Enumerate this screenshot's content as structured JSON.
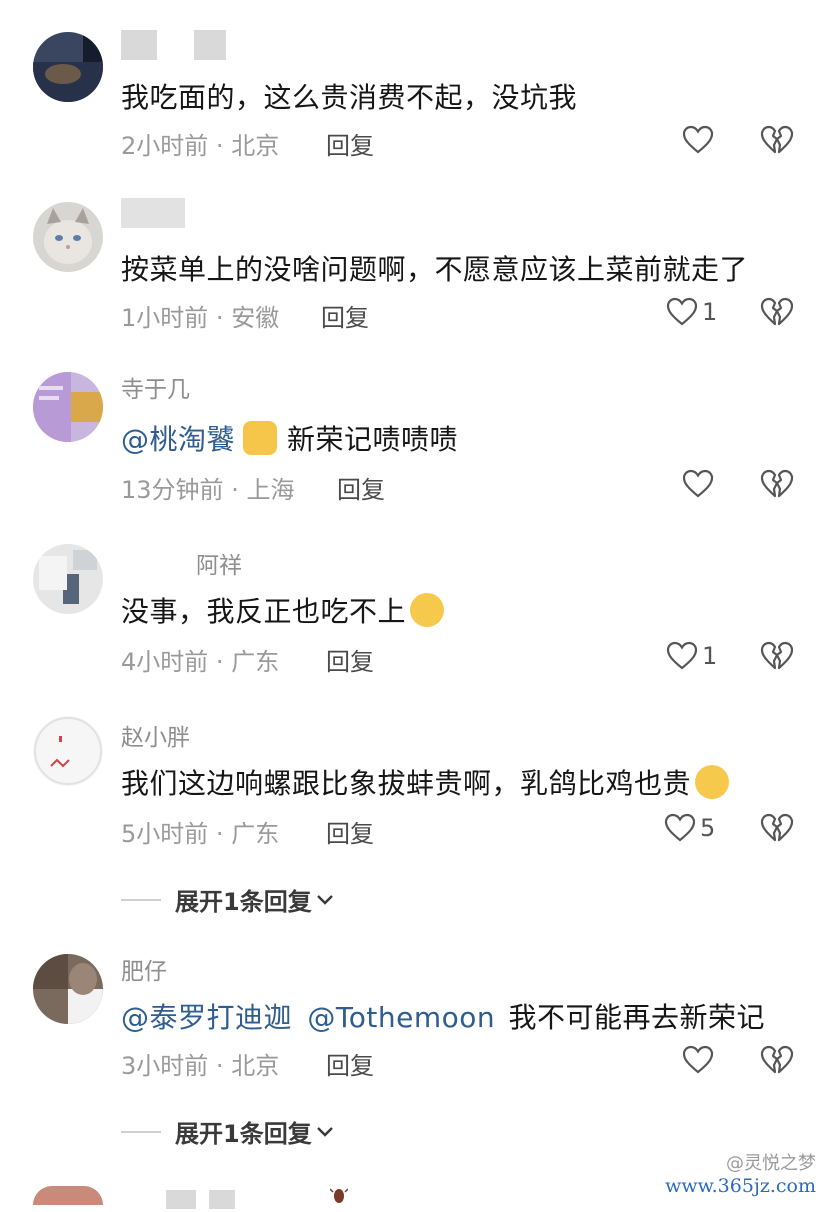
{
  "comments": [
    {
      "text": "我吃面的，这么贵消费不起，没坑我",
      "time": "2小时前",
      "location": "北京",
      "reply": "回复",
      "likes": ""
    },
    {
      "text": "按菜单上的没啥问题啊，不愿意应该上菜前就走了",
      "time": "1小时前",
      "location": "安徽",
      "reply": "回复",
      "likes": "1"
    },
    {
      "username": "寺于几",
      "mention": "@桃淘饕",
      "text": "新荣记啧啧啧",
      "time": "13分钟前",
      "location": "上海",
      "reply": "回复",
      "likes": ""
    },
    {
      "username": "阿祥",
      "text": "没事，我反正也吃不上",
      "time": "4小时前",
      "location": "广东",
      "reply": "回复",
      "likes": "1"
    },
    {
      "username": "赵小胖",
      "text": "我们这边响螺跟比象拔蚌贵啊，乳鸽比鸡也贵",
      "time": "5小时前",
      "location": "广东",
      "reply": "回复",
      "likes": "5",
      "expand": "展开1条回复"
    },
    {
      "username": "肥仔",
      "mention1": "@泰罗打迪迦",
      "mention2": "@Tothemoon",
      "text": "我不可能再去新荣记",
      "time": "3小时前",
      "location": "北京",
      "reply": "回复",
      "likes": "",
      "expand": "展开1条回复"
    }
  ],
  "separator": "·",
  "watermark": {
    "brand": "@灵悦之梦",
    "site": "www.365jz.com"
  },
  "colors": {
    "mention": "#2f5d8f",
    "meta": "#9a9a9a",
    "icon": "#555555"
  }
}
